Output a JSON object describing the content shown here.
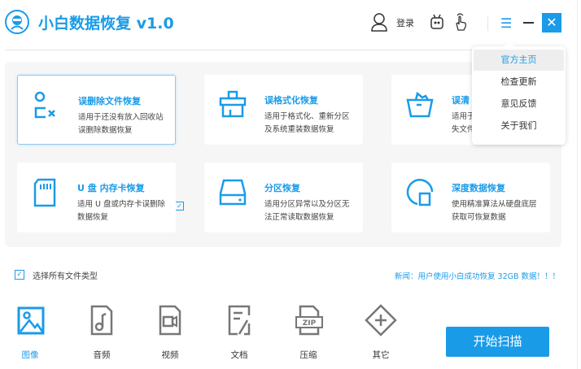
{
  "app": {
    "title": "小白数据恢复 v1.0",
    "login": "登录",
    "close": "✕"
  },
  "cards": [
    {
      "title": "误删除文件恢复",
      "desc1": "适用于还没有放入回收站",
      "desc2": "误删除数据恢复",
      "selected": true
    },
    {
      "title": "误格式化恢复",
      "desc1": "适用于格式化、重新分区",
      "desc2": "及系统重装数据恢复"
    },
    {
      "title": "误清",
      "desc1": "适用于",
      "desc2": "失文件"
    },
    {
      "title": "U 盘 内存卡恢复",
      "desc1": "适用 U 盘或内存卡误删除",
      "desc2": "数据恢复"
    },
    {
      "title": "分区恢复",
      "desc1": "适用分区异常以及分区无",
      "desc2": "法正常读取数据恢复"
    },
    {
      "title": "深度数据恢复",
      "desc1": "使用精准算法从硬盘底层",
      "desc2": "获取可恢复数据"
    }
  ],
  "menu": [
    "官方主页",
    "检查更新",
    "意见反馈",
    "关于我们"
  ],
  "select_all": "选择所有文件类型",
  "news": "新闻：用户使用小白成功恢复 32GB 数据！！！",
  "file_types": [
    "图像",
    "音频",
    "视频",
    "文档",
    "压缩",
    "其它"
  ],
  "start": "开始扫描",
  "colors": {
    "accent": "#1a9be8"
  }
}
